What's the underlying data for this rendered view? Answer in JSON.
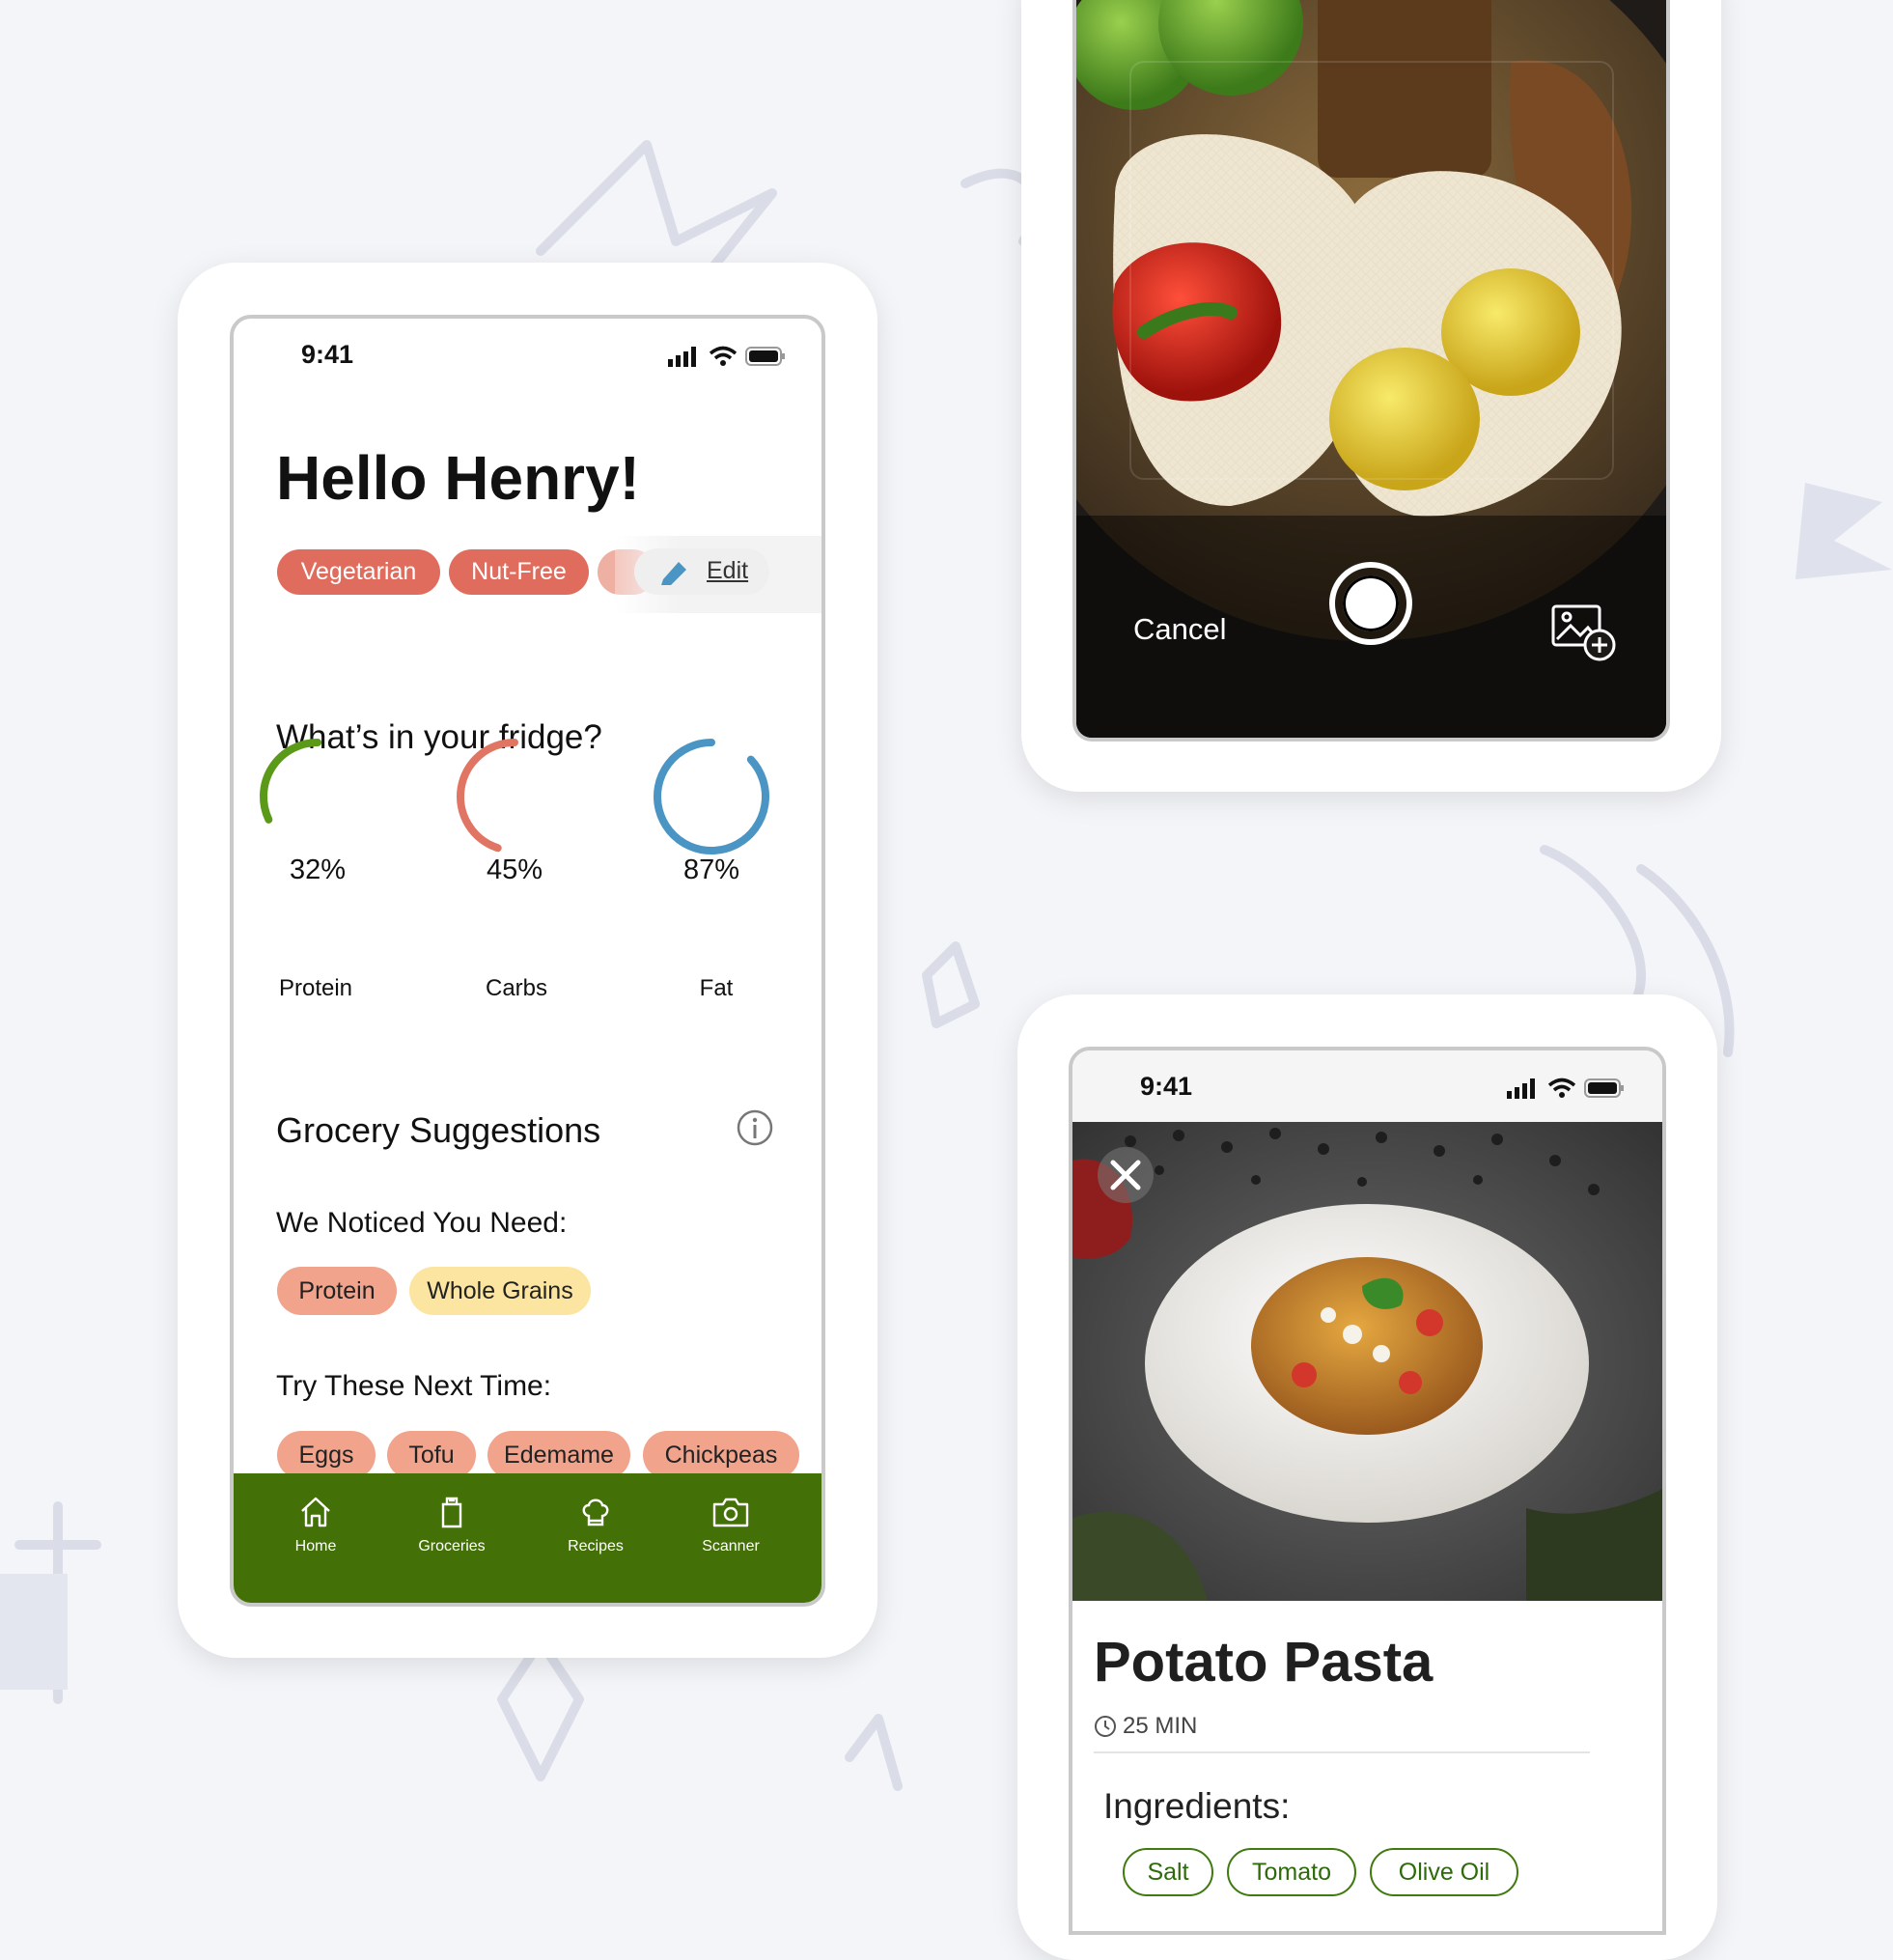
{
  "home": {
    "status_time": "9:41",
    "greeting": "Hello Henry!",
    "diet_tags": [
      "Vegetarian",
      "Nut-Free"
    ],
    "edit_label": "Edit",
    "fridge_heading": "What’s in your fridge?",
    "macros": [
      {
        "label": "Protein",
        "percent_text": "32%",
        "fraction": 0.32,
        "color": "#5a9a18"
      },
      {
        "label": "Carbs",
        "percent_text": "45%",
        "fraction": 0.45,
        "color": "#e07563"
      },
      {
        "label": "Fat",
        "percent_text": "87%",
        "fraction": 0.87,
        "color": "#4b95c4"
      }
    ],
    "suggestions_heading": "Grocery Suggestions",
    "noticed_heading": "We Noticed You Need:",
    "needs": [
      {
        "label": "Protein",
        "color": "#f1a38c"
      },
      {
        "label": "Whole Grains",
        "color": "#fbe5a0"
      }
    ],
    "try_heading": "Try These Next Time:",
    "try_items": [
      "Eggs",
      "Tofu",
      "Edemame",
      "Chickpeas"
    ],
    "nav": [
      {
        "label": "Home",
        "icon": "home-icon"
      },
      {
        "label": "Groceries",
        "icon": "grocery-bag-icon"
      },
      {
        "label": "Recipes",
        "icon": "chef-hat-icon"
      },
      {
        "label": "Scanner",
        "icon": "camera-icon"
      }
    ],
    "nav_color": "#437107",
    "tag_color": "#e06c5d"
  },
  "scanner": {
    "cancel_label": "Cancel"
  },
  "recipe": {
    "status_time": "9:41",
    "title": "Potato Pasta",
    "time": "25 MIN",
    "ingredients_heading": "Ingredients:",
    "ingredients": [
      "Salt",
      "Tomato",
      "Olive Oil"
    ]
  }
}
